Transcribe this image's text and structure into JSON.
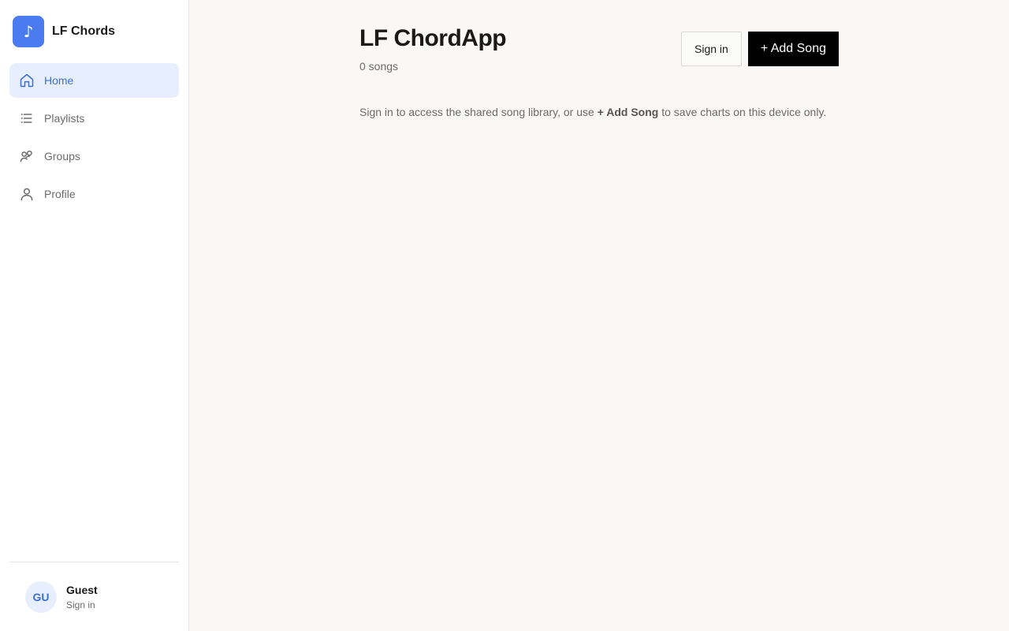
{
  "brand": {
    "logo_glyph": "♪",
    "name": "LF Chords",
    "accent_color": "#4a7cf0"
  },
  "sidebar": {
    "items": [
      {
        "label": "Home",
        "icon": "home-icon",
        "active": true
      },
      {
        "label": "Playlists",
        "icon": "list-icon",
        "active": false
      },
      {
        "label": "Groups",
        "icon": "users-icon",
        "active": false
      },
      {
        "label": "Profile",
        "icon": "user-icon",
        "active": false
      }
    ],
    "user": {
      "initials": "GU",
      "name": "Guest",
      "sub": "Sign in"
    }
  },
  "main": {
    "title": "LF ChordApp",
    "count": "0 songs",
    "sign_in_label": "Sign in",
    "add_song_label": "+ Add Song",
    "message": {
      "before": "Sign in to access the shared song library, or use ",
      "bold": "+ Add Song",
      "after": " to save charts on this device only."
    }
  }
}
